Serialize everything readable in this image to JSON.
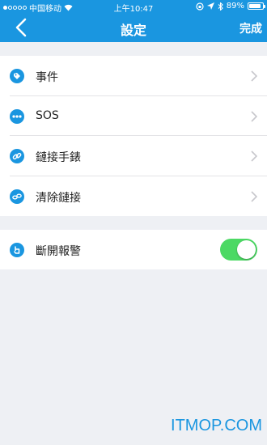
{
  "status_bar": {
    "carrier": "中国移动",
    "time": "上午10:47",
    "battery": "89%",
    "battery_level": 0.89
  },
  "navbar": {
    "title": "設定",
    "done_label": "完成",
    "back_icon": "chevron-left-icon"
  },
  "settings": {
    "items": [
      {
        "label": "事件",
        "icon": "tag-icon"
      },
      {
        "label": "SOS",
        "icon": "more-dots-icon"
      },
      {
        "label": "鏈接手錶",
        "icon": "link-icon"
      },
      {
        "label": "清除鏈接",
        "icon": "unlink-icon"
      }
    ],
    "alarm": {
      "label": "斷開報警",
      "icon": "hand-tap-icon",
      "enabled": true
    }
  },
  "watermark": "ITMOP.COM",
  "colors": {
    "accent": "#1a96e0",
    "toggle_on": "#4cd964",
    "background": "#eef0f4"
  }
}
